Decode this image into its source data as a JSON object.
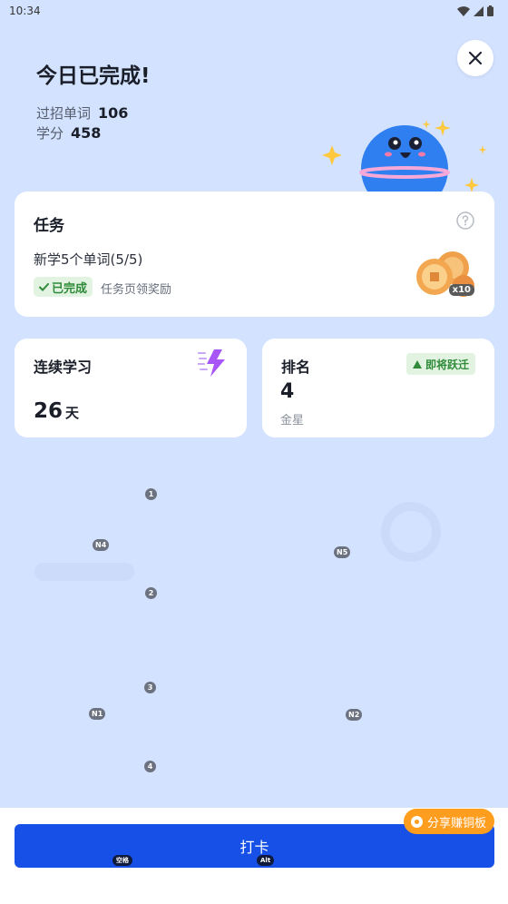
{
  "status_bar": {
    "time": "10:34",
    "icons": [
      "wifi-icon",
      "signal-icon",
      "battery-icon"
    ]
  },
  "header": {
    "title": "今日已完成!",
    "words_label": "过招单词",
    "words_value": "106",
    "score_label": "学分",
    "score_value": "458"
  },
  "task": {
    "title": "任务",
    "description": "新学5个单词(5/5)",
    "status": "已完成",
    "reward_note": "任务页领奖励",
    "coin_count": "x10"
  },
  "streak": {
    "label": "连续学习",
    "value": "26",
    "unit": "天"
  },
  "rank": {
    "label": "排名",
    "value": "4",
    "tier": "金星",
    "badge": "即将跃迁"
  },
  "hints": [
    "1",
    "N4",
    "N5",
    "2",
    "3",
    "N1",
    "N2",
    "4"
  ],
  "bottom": {
    "checkin_label": "打卡",
    "share_label": "分享赚铜板",
    "key_space": "空格",
    "key_alt": "Alt"
  },
  "colors": {
    "background": "#d3e2ff",
    "primary": "#1650e6",
    "accent": "#ff9d1f",
    "success": "#2f8a3a"
  }
}
